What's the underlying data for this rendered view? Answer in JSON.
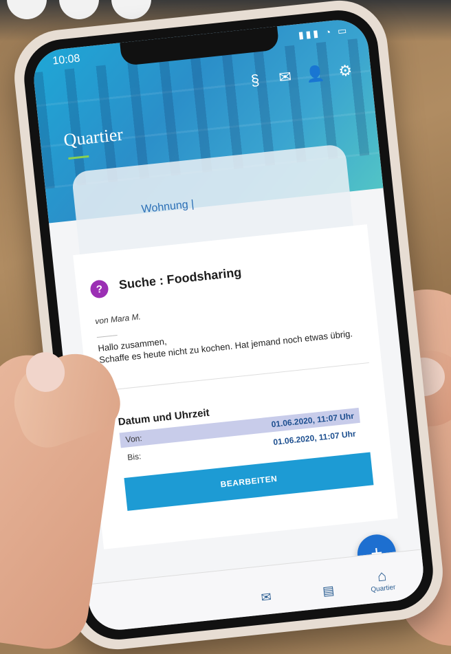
{
  "status_bar": {
    "time": "10:08",
    "icons": "▮▮▮ ◔ ▭"
  },
  "header": {
    "title": "Quartier",
    "icons": [
      "paragraph-icon",
      "inbox-icon",
      "user-icon",
      "gear-icon"
    ],
    "icon_glyphs": [
      "§",
      "✉",
      "👤",
      "⚙"
    ]
  },
  "location": {
    "label": "Wohnung |"
  },
  "post": {
    "badge": "?",
    "title": "Suche : Foodsharing",
    "author": "von Mara M.",
    "body_line1": "Hallo zusammen,",
    "body_line2": "Schaffe es heute nicht zu kochen. Hat jemand noch etwas übrig."
  },
  "schedule": {
    "heading": "Datum und Uhrzeit",
    "von_label": "Von:",
    "von_value": "01.06.2020, 11:07 Uhr",
    "bis_label": "Bis:",
    "bis_value": "01.06.2020, 11:07 Uhr"
  },
  "actions": {
    "edit_label": "BEARBEITEN",
    "fab_label": "+"
  },
  "tabbar": {
    "quartier_label": "Quartier"
  },
  "colors": {
    "accent": "#1d9bd4",
    "badge": "#9b2fb4",
    "fab": "#1d6fd0"
  }
}
